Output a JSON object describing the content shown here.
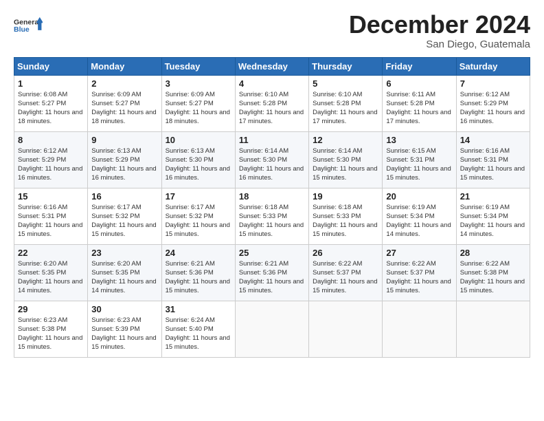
{
  "logo": {
    "line1": "General",
    "line2": "Blue"
  },
  "header": {
    "title": "December 2024",
    "subtitle": "San Diego, Guatemala"
  },
  "days_of_week": [
    "Sunday",
    "Monday",
    "Tuesday",
    "Wednesday",
    "Thursday",
    "Friday",
    "Saturday"
  ],
  "weeks": [
    [
      {
        "day": "1",
        "sunrise": "6:08 AM",
        "sunset": "5:27 PM",
        "daylight": "11 hours and 18 minutes."
      },
      {
        "day": "2",
        "sunrise": "6:09 AM",
        "sunset": "5:27 PM",
        "daylight": "11 hours and 18 minutes."
      },
      {
        "day": "3",
        "sunrise": "6:09 AM",
        "sunset": "5:27 PM",
        "daylight": "11 hours and 18 minutes."
      },
      {
        "day": "4",
        "sunrise": "6:10 AM",
        "sunset": "5:28 PM",
        "daylight": "11 hours and 17 minutes."
      },
      {
        "day": "5",
        "sunrise": "6:10 AM",
        "sunset": "5:28 PM",
        "daylight": "11 hours and 17 minutes."
      },
      {
        "day": "6",
        "sunrise": "6:11 AM",
        "sunset": "5:28 PM",
        "daylight": "11 hours and 17 minutes."
      },
      {
        "day": "7",
        "sunrise": "6:12 AM",
        "sunset": "5:29 PM",
        "daylight": "11 hours and 16 minutes."
      }
    ],
    [
      {
        "day": "8",
        "sunrise": "6:12 AM",
        "sunset": "5:29 PM",
        "daylight": "11 hours and 16 minutes."
      },
      {
        "day": "9",
        "sunrise": "6:13 AM",
        "sunset": "5:29 PM",
        "daylight": "11 hours and 16 minutes."
      },
      {
        "day": "10",
        "sunrise": "6:13 AM",
        "sunset": "5:30 PM",
        "daylight": "11 hours and 16 minutes."
      },
      {
        "day": "11",
        "sunrise": "6:14 AM",
        "sunset": "5:30 PM",
        "daylight": "11 hours and 16 minutes."
      },
      {
        "day": "12",
        "sunrise": "6:14 AM",
        "sunset": "5:30 PM",
        "daylight": "11 hours and 15 minutes."
      },
      {
        "day": "13",
        "sunrise": "6:15 AM",
        "sunset": "5:31 PM",
        "daylight": "11 hours and 15 minutes."
      },
      {
        "day": "14",
        "sunrise": "6:16 AM",
        "sunset": "5:31 PM",
        "daylight": "11 hours and 15 minutes."
      }
    ],
    [
      {
        "day": "15",
        "sunrise": "6:16 AM",
        "sunset": "5:31 PM",
        "daylight": "11 hours and 15 minutes."
      },
      {
        "day": "16",
        "sunrise": "6:17 AM",
        "sunset": "5:32 PM",
        "daylight": "11 hours and 15 minutes."
      },
      {
        "day": "17",
        "sunrise": "6:17 AM",
        "sunset": "5:32 PM",
        "daylight": "11 hours and 15 minutes."
      },
      {
        "day": "18",
        "sunrise": "6:18 AM",
        "sunset": "5:33 PM",
        "daylight": "11 hours and 15 minutes."
      },
      {
        "day": "19",
        "sunrise": "6:18 AM",
        "sunset": "5:33 PM",
        "daylight": "11 hours and 15 minutes."
      },
      {
        "day": "20",
        "sunrise": "6:19 AM",
        "sunset": "5:34 PM",
        "daylight": "11 hours and 14 minutes."
      },
      {
        "day": "21",
        "sunrise": "6:19 AM",
        "sunset": "5:34 PM",
        "daylight": "11 hours and 14 minutes."
      }
    ],
    [
      {
        "day": "22",
        "sunrise": "6:20 AM",
        "sunset": "5:35 PM",
        "daylight": "11 hours and 14 minutes."
      },
      {
        "day": "23",
        "sunrise": "6:20 AM",
        "sunset": "5:35 PM",
        "daylight": "11 hours and 14 minutes."
      },
      {
        "day": "24",
        "sunrise": "6:21 AM",
        "sunset": "5:36 PM",
        "daylight": "11 hours and 15 minutes."
      },
      {
        "day": "25",
        "sunrise": "6:21 AM",
        "sunset": "5:36 PM",
        "daylight": "11 hours and 15 minutes."
      },
      {
        "day": "26",
        "sunrise": "6:22 AM",
        "sunset": "5:37 PM",
        "daylight": "11 hours and 15 minutes."
      },
      {
        "day": "27",
        "sunrise": "6:22 AM",
        "sunset": "5:37 PM",
        "daylight": "11 hours and 15 minutes."
      },
      {
        "day": "28",
        "sunrise": "6:22 AM",
        "sunset": "5:38 PM",
        "daylight": "11 hours and 15 minutes."
      }
    ],
    [
      {
        "day": "29",
        "sunrise": "6:23 AM",
        "sunset": "5:38 PM",
        "daylight": "11 hours and 15 minutes."
      },
      {
        "day": "30",
        "sunrise": "6:23 AM",
        "sunset": "5:39 PM",
        "daylight": "11 hours and 15 minutes."
      },
      {
        "day": "31",
        "sunrise": "6:24 AM",
        "sunset": "5:40 PM",
        "daylight": "11 hours and 15 minutes."
      },
      null,
      null,
      null,
      null
    ]
  ]
}
